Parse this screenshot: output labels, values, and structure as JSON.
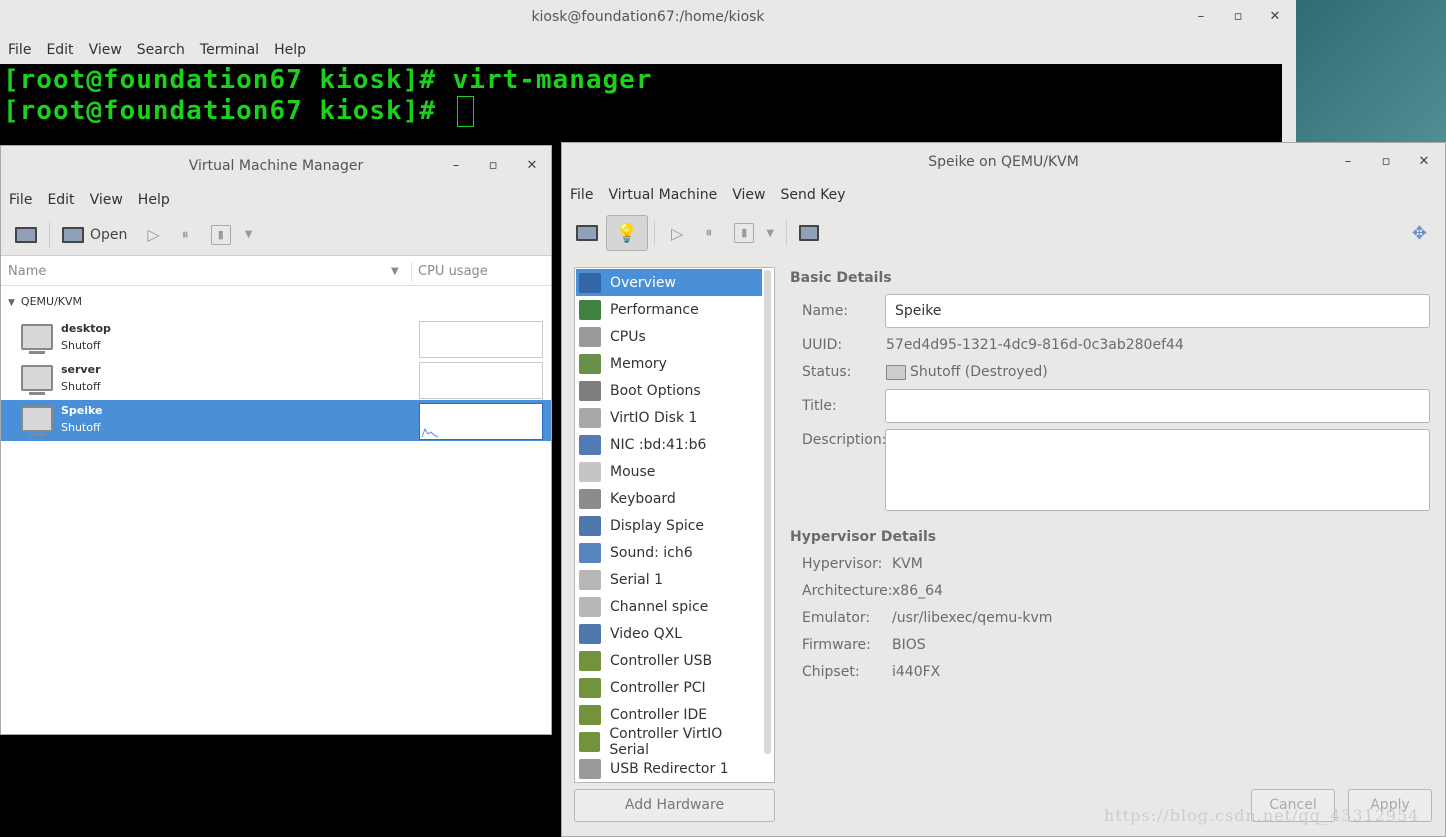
{
  "terminal": {
    "title": "kiosk@foundation67:/home/kiosk",
    "menu": [
      "File",
      "Edit",
      "View",
      "Search",
      "Terminal",
      "Help"
    ],
    "lines": [
      "[root@foundation67 kiosk]# virt-manager",
      "[root@foundation67 kiosk]# "
    ]
  },
  "vmm": {
    "title": "Virtual Machine Manager",
    "menu": [
      "File",
      "Edit",
      "View",
      "Help"
    ],
    "toolbar": {
      "open_label": "Open"
    },
    "columns": [
      "Name",
      "CPU usage"
    ],
    "group": "QEMU/KVM",
    "vms": [
      {
        "name": "desktop",
        "status": "Shutoff"
      },
      {
        "name": "server",
        "status": "Shutoff"
      },
      {
        "name": "Speike",
        "status": "Shutoff"
      }
    ]
  },
  "details": {
    "title": "Speike on QEMU/KVM",
    "menu": [
      "File",
      "Virtual Machine",
      "View",
      "Send Key"
    ],
    "hardware": [
      "Overview",
      "Performance",
      "CPUs",
      "Memory",
      "Boot Options",
      "VirtIO Disk 1",
      "NIC :bd:41:b6",
      "Mouse",
      "Keyboard",
      "Display Spice",
      "Sound: ich6",
      "Serial 1",
      "Channel spice",
      "Video QXL",
      "Controller USB",
      "Controller PCI",
      "Controller IDE",
      "Controller VirtIO Serial",
      "USB Redirector 1"
    ],
    "add_hardware": "Add Hardware",
    "basic_title": "Basic Details",
    "labels": {
      "name": "Name:",
      "uuid": "UUID:",
      "status": "Status:",
      "title": "Title:",
      "description": "Description:"
    },
    "values": {
      "name": "Speike",
      "uuid": "57ed4d95-1321-4dc9-816d-0c3ab280ef44",
      "status": "Shutoff (Destroyed)",
      "title": "",
      "description": ""
    },
    "hyper_title": "Hypervisor Details",
    "hyper": [
      {
        "label": "Hypervisor:",
        "value": "KVM"
      },
      {
        "label": "Architecture:",
        "value": "x86_64"
      },
      {
        "label": "Emulator:",
        "value": "/usr/libexec/qemu-kvm"
      },
      {
        "label": "Firmware:",
        "value": "BIOS"
      },
      {
        "label": "Chipset:",
        "value": "i440FX"
      }
    ],
    "cancel": "Cancel",
    "apply": "Apply"
  },
  "watermark": "https://blog.csdn.net/qq_43312954",
  "colors": {
    "terminal_text": "#1cd11c",
    "selection": "#4a90d9"
  }
}
